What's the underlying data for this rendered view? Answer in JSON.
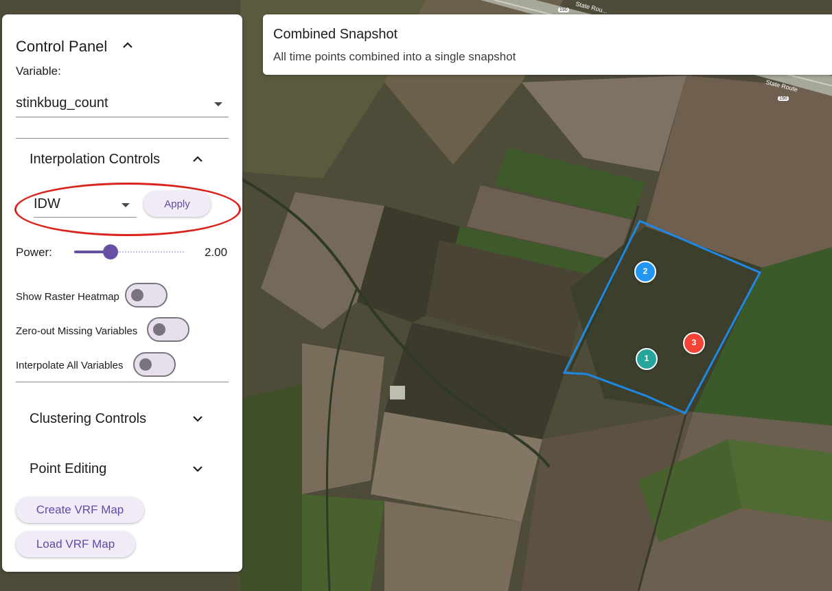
{
  "panel": {
    "title": "Control Panel",
    "variable_label": "Variable:",
    "variable_value": "stinkbug_count",
    "interpolation": {
      "title": "Interpolation Controls",
      "method": "IDW",
      "apply_label": "Apply",
      "power_label": "Power:",
      "power_value": "2.00",
      "power_fraction": 0.33,
      "toggles": [
        {
          "label": "Show Raster Heatmap",
          "on": false
        },
        {
          "label": "Zero-out Missing Variables",
          "on": false
        },
        {
          "label": "Interpolate All Variables",
          "on": false
        }
      ]
    },
    "clustering_title": "Clustering Controls",
    "point_editing_title": "Point Editing",
    "create_vrf_label": "Create VRF Map",
    "load_vrf_label": "Load VRF Map"
  },
  "map_card": {
    "title": "Combined Snapshot",
    "subtitle": "All time points combined into a single snapshot"
  },
  "markers": [
    {
      "label": "2",
      "color": "#2196f3"
    },
    {
      "label": "1",
      "color": "#26a69a"
    },
    {
      "label": "3",
      "color": "#f44336"
    }
  ],
  "map": {
    "road_label": "State Rou...",
    "road_label_2": "State Route",
    "road_shield": "190",
    "boundary_color": "#1e88e5"
  },
  "colors": {
    "accent": "#6750a4",
    "highlight": "#d9241d"
  }
}
